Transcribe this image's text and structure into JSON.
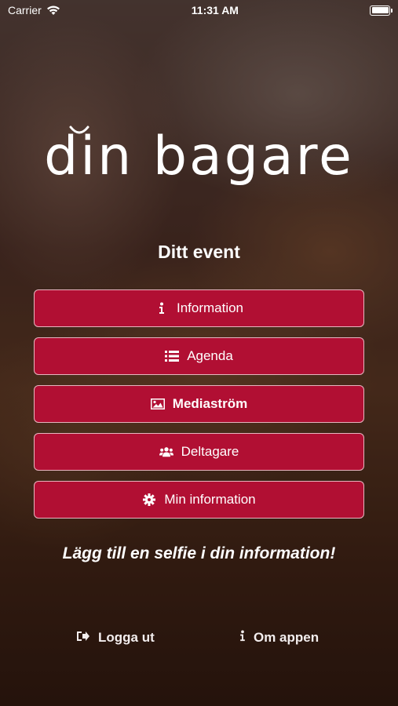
{
  "status_bar": {
    "carrier": "Carrier",
    "time": "11:31 AM"
  },
  "logo": {
    "text": "din bagare"
  },
  "event_title": "Ditt event",
  "menu": [
    {
      "label": "Information",
      "icon": "info-icon"
    },
    {
      "label": "Agenda",
      "icon": "list-icon"
    },
    {
      "label": "Mediaström",
      "icon": "image-icon"
    },
    {
      "label": "Deltagare",
      "icon": "users-icon"
    },
    {
      "label": "Min information",
      "icon": "gear-icon"
    }
  ],
  "selfie_prompt": "Lägg till en selfie i din information!",
  "footer": {
    "logout_label": "Logga ut",
    "about_label": "Om appen"
  },
  "colors": {
    "button_bg": "#b10f33",
    "button_border": "#e8b4bf",
    "text": "#ffffff"
  }
}
